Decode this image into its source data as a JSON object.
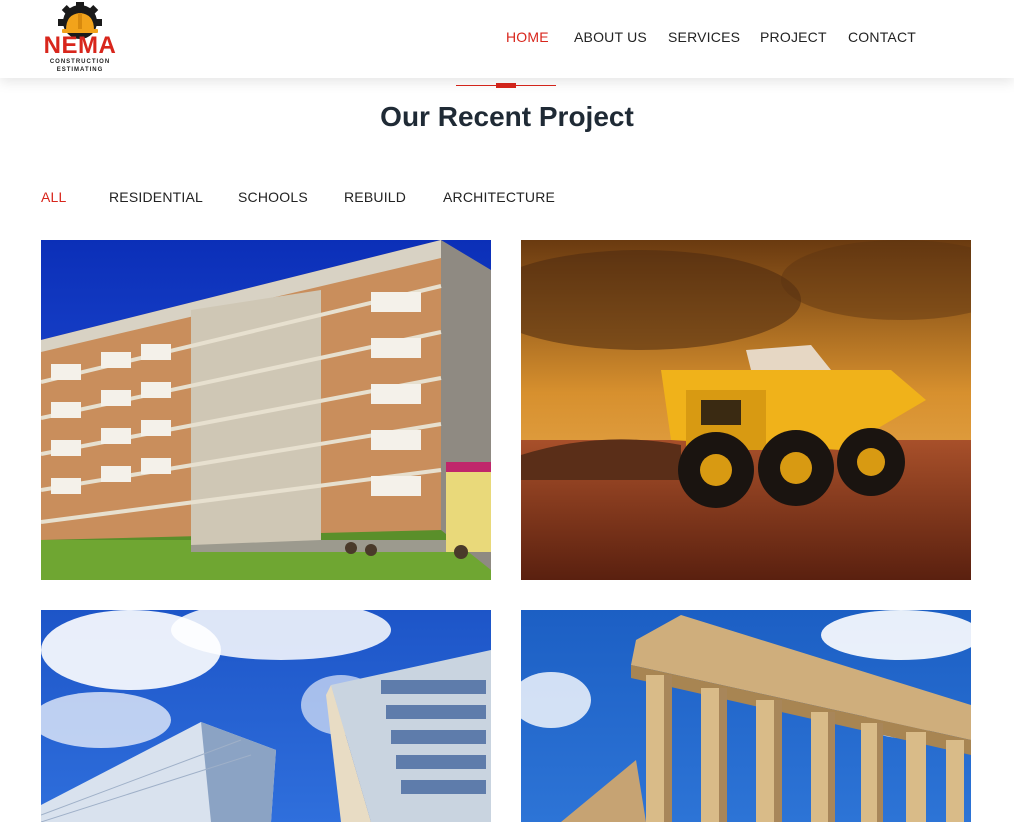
{
  "brand": {
    "name": "NEMA",
    "tagline_line1": "CONSTRUCTION",
    "tagline_line2": "ESTIMATING",
    "accent_color": "#d8261c"
  },
  "nav": {
    "items": [
      {
        "label": "HOME",
        "active": true
      },
      {
        "label": "ABOUT US",
        "active": false
      },
      {
        "label": "SERVICES",
        "active": false
      },
      {
        "label": "PROJECT",
        "active": false
      },
      {
        "label": "CONTACT",
        "active": false
      }
    ]
  },
  "section": {
    "title": "Our Recent Project"
  },
  "filters": {
    "items": [
      {
        "label": "ALL",
        "active": true
      },
      {
        "label": "RESIDENTIAL",
        "active": false
      },
      {
        "label": "SCHOOLS",
        "active": false
      },
      {
        "label": "REBUILD",
        "active": false
      },
      {
        "label": "ARCHITECTURE",
        "active": false
      }
    ]
  },
  "projects": [
    {
      "image": "apartment-building-photo"
    },
    {
      "image": "mining-dump-truck-photo"
    },
    {
      "image": "glass-skyscrapers-photo"
    },
    {
      "image": "greek-temple-ruins-photo"
    }
  ]
}
